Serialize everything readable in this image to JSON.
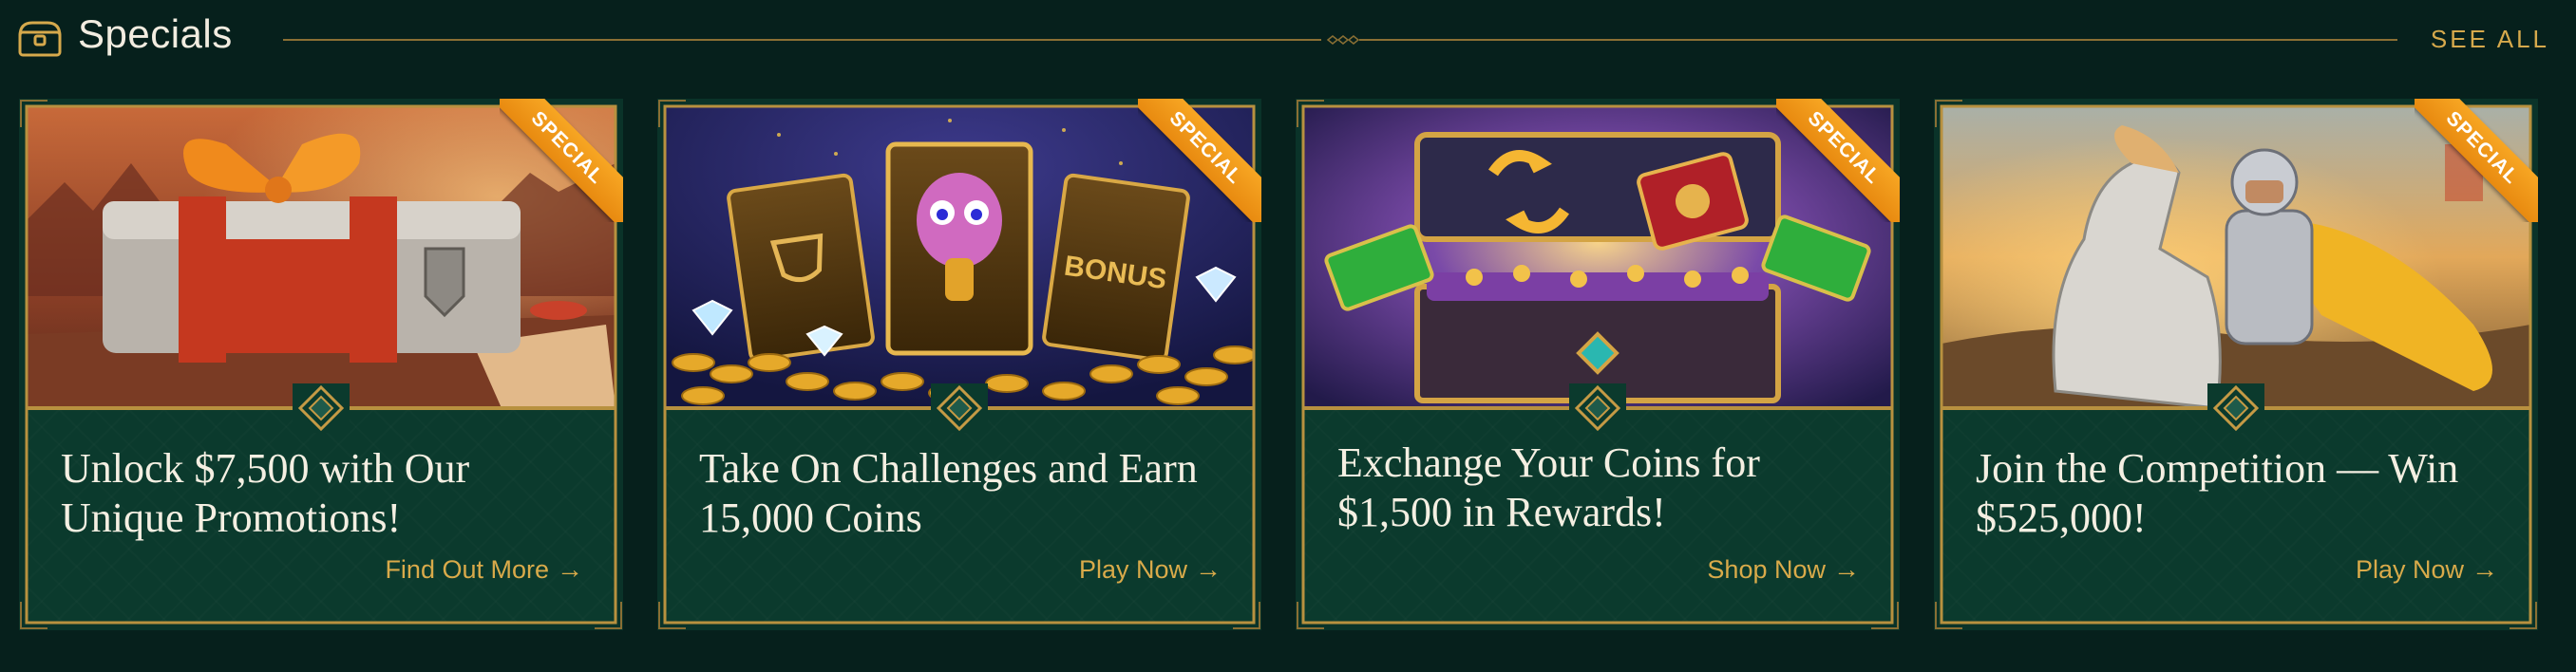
{
  "header": {
    "title": "Specials",
    "see_all_label": "SEE ALL",
    "icon": "chest-icon"
  },
  "badge_label": "SPECIAL",
  "colors": {
    "background": "#06201c",
    "card": "#0b3a2d",
    "gold": "#d9aa4a",
    "ribbon": "#f29a1a"
  },
  "cards": [
    {
      "title": "Unlock $7,500 with Our Unique Promotions!",
      "cta": "Find Out More",
      "art": "gift-box-illustration"
    },
    {
      "title": "Take On Challenges and Earn 15,000 Coins",
      "cta": "Play Now",
      "art": "bonus-cards-coins-illustration"
    },
    {
      "title": "Exchange Your Coins for $1,500 in Rewards!",
      "cta": "Shop Now",
      "art": "treasure-chest-illustration"
    },
    {
      "title": "Join the Competition — Win $525,000!",
      "cta": "Play Now",
      "art": "knight-on-horse-illustration"
    }
  ]
}
